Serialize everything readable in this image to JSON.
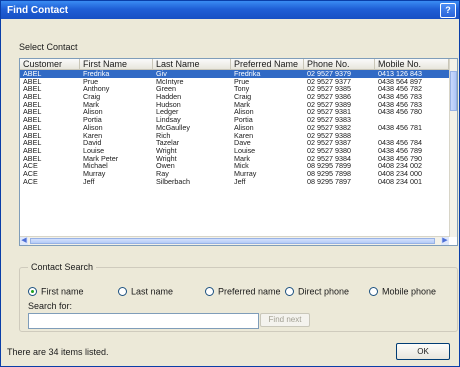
{
  "window": {
    "title": "Find Contact",
    "help_label": "?"
  },
  "select_contact_label": "Select Contact",
  "columns": [
    "Customer",
    "First Name",
    "Last Name",
    "Preferred Name",
    "Phone No.",
    "Mobile No."
  ],
  "rows": [
    [
      "ABEL",
      "Fredrika",
      "Giv",
      "Fredrika",
      "02 9527 9379",
      "0413 126 843"
    ],
    [
      "ABEL",
      "Prue",
      "McIntyre",
      "Prue",
      "02 9527 9377",
      "0438 564 897"
    ],
    [
      "ABEL",
      "Anthony",
      "Green",
      "Tony",
      "02 9527 9385",
      "0438 456 782"
    ],
    [
      "ABEL",
      "Craig",
      "Hadden",
      "Craig",
      "02 9527 9386",
      "0438 456 783"
    ],
    [
      "ABEL",
      "Mark",
      "Hudson",
      "Mark",
      "02 9527 9389",
      "0438 456 783"
    ],
    [
      "ABEL",
      "Alison",
      "Ledger",
      "Alison",
      "02 9527 9381",
      "0438 456 780"
    ],
    [
      "ABEL",
      "Portia",
      "Lindsay",
      "Portia",
      "02 9527 9383",
      ""
    ],
    [
      "ABEL",
      "Alison",
      "McGaulley",
      "Alison",
      "02 9527 9382",
      "0438 456 781"
    ],
    [
      "ABEL",
      "Karen",
      "Rich",
      "Karen",
      "02 9527 9388",
      ""
    ],
    [
      "ABEL",
      "David",
      "Tazelar",
      "Dave",
      "02 9527 9387",
      "0438 456 784"
    ],
    [
      "ABEL",
      "Louise",
      "Wright",
      "Louise",
      "02 9527 9380",
      "0438 456 789"
    ],
    [
      "ABEL",
      "Mark Peter",
      "Wright",
      "Mark",
      "02 9527 9384",
      "0438 456 790"
    ],
    [
      "ACE",
      "Michael",
      "Owen",
      "Mick",
      "08 9295 7899",
      "0408 234 002"
    ],
    [
      "ACE",
      "Murray",
      "Ray",
      "Murray",
      "08 9295 7898",
      "0408 234 000"
    ],
    [
      "ACE",
      "Jeff",
      "Silberbach",
      "Jeff",
      "08 9295 7897",
      "0408 234 001"
    ]
  ],
  "selected_row": 0,
  "contact_search": {
    "legend": "Contact Search",
    "options": [
      {
        "label": "First name",
        "selected": true
      },
      {
        "label": "Last name",
        "selected": false
      },
      {
        "label": "Preferred name",
        "selected": false
      },
      {
        "label": "Direct phone",
        "selected": false
      },
      {
        "label": "Mobile phone",
        "selected": false
      }
    ],
    "search_for_label": "Search for:",
    "search_value": "",
    "find_next_label": "Find next"
  },
  "status_text": "There are 34 items listed.",
  "ok_label": "OK"
}
